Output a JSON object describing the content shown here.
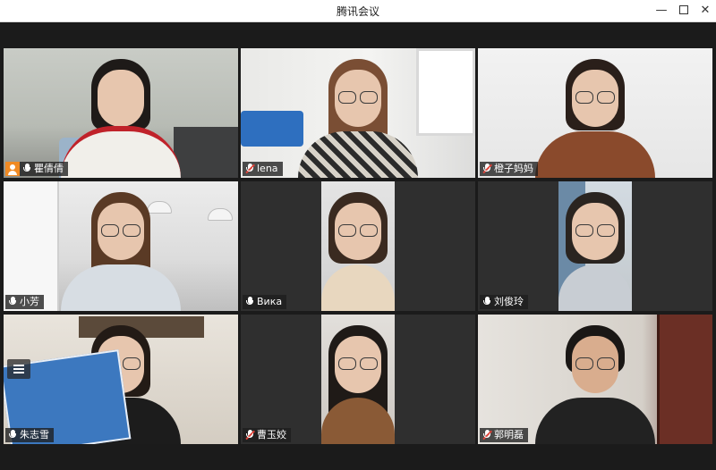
{
  "window": {
    "title": "腾讯会议",
    "minimize_glyph": "—",
    "close_glyph": "✕"
  },
  "participants": [
    {
      "name": "瞿倩倩",
      "mic": "on",
      "host": true
    },
    {
      "name": "lena",
      "mic": "muted",
      "host": false
    },
    {
      "name": "橙子妈妈",
      "mic": "muted",
      "host": false
    },
    {
      "name": "小芳",
      "mic": "on",
      "host": false
    },
    {
      "name": "Вика",
      "mic": "on",
      "host": false
    },
    {
      "name": "刘俊玲",
      "mic": "on",
      "host": false
    },
    {
      "name": "朱志雪",
      "mic": "on",
      "host": false,
      "active_speaker": true
    },
    {
      "name": "曹玉姣",
      "mic": "muted",
      "host": false
    },
    {
      "name": "郭明磊",
      "mic": "muted",
      "host": false
    }
  ],
  "icons": {
    "host": "host-person-icon",
    "mic": "microphone-icon",
    "mic_muted": "microphone-muted-icon",
    "menu": "menu-icon"
  },
  "colors": {
    "active_speaker_border": "#2fbf67",
    "host_badge": "#f08a24",
    "muted_slash": "#e0443a"
  }
}
